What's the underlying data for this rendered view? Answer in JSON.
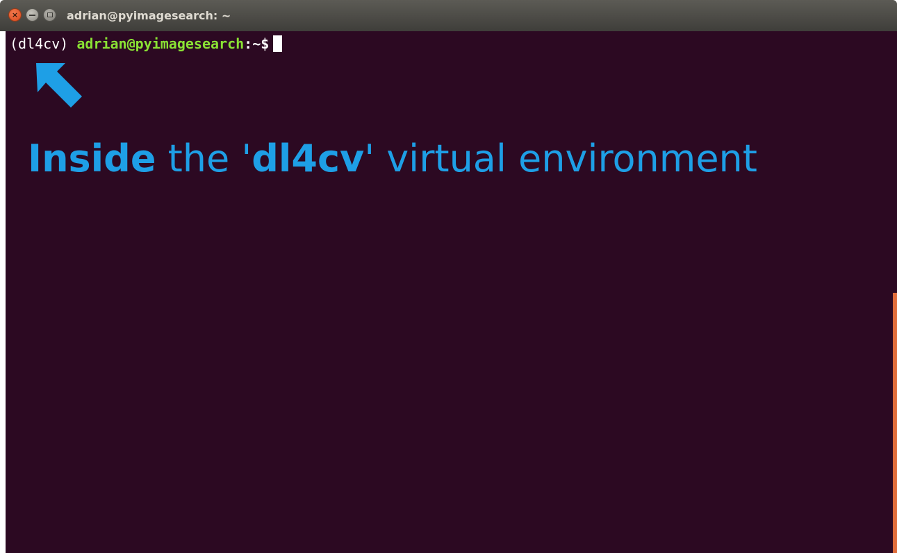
{
  "window": {
    "title": "adrian@pyimagesearch: ~",
    "close_glyph": "×",
    "controls": [
      "close-icon",
      "minimize-icon",
      "maximize-icon"
    ]
  },
  "terminal": {
    "env": "(dl4cv)",
    "user_host": "adrian@pyimagesearch",
    "path": ":~$",
    "background": "#2c0922",
    "prompt_user_color": "#8ae234"
  },
  "annotation": {
    "word1": "Inside",
    "word2": " the '",
    "word3": "dl4cv",
    "word4": "' virtual environment",
    "color": "#1e9fe6",
    "icon": "arrow-up-left-icon"
  },
  "colors": {
    "scrollbar": "#e06d3b"
  }
}
